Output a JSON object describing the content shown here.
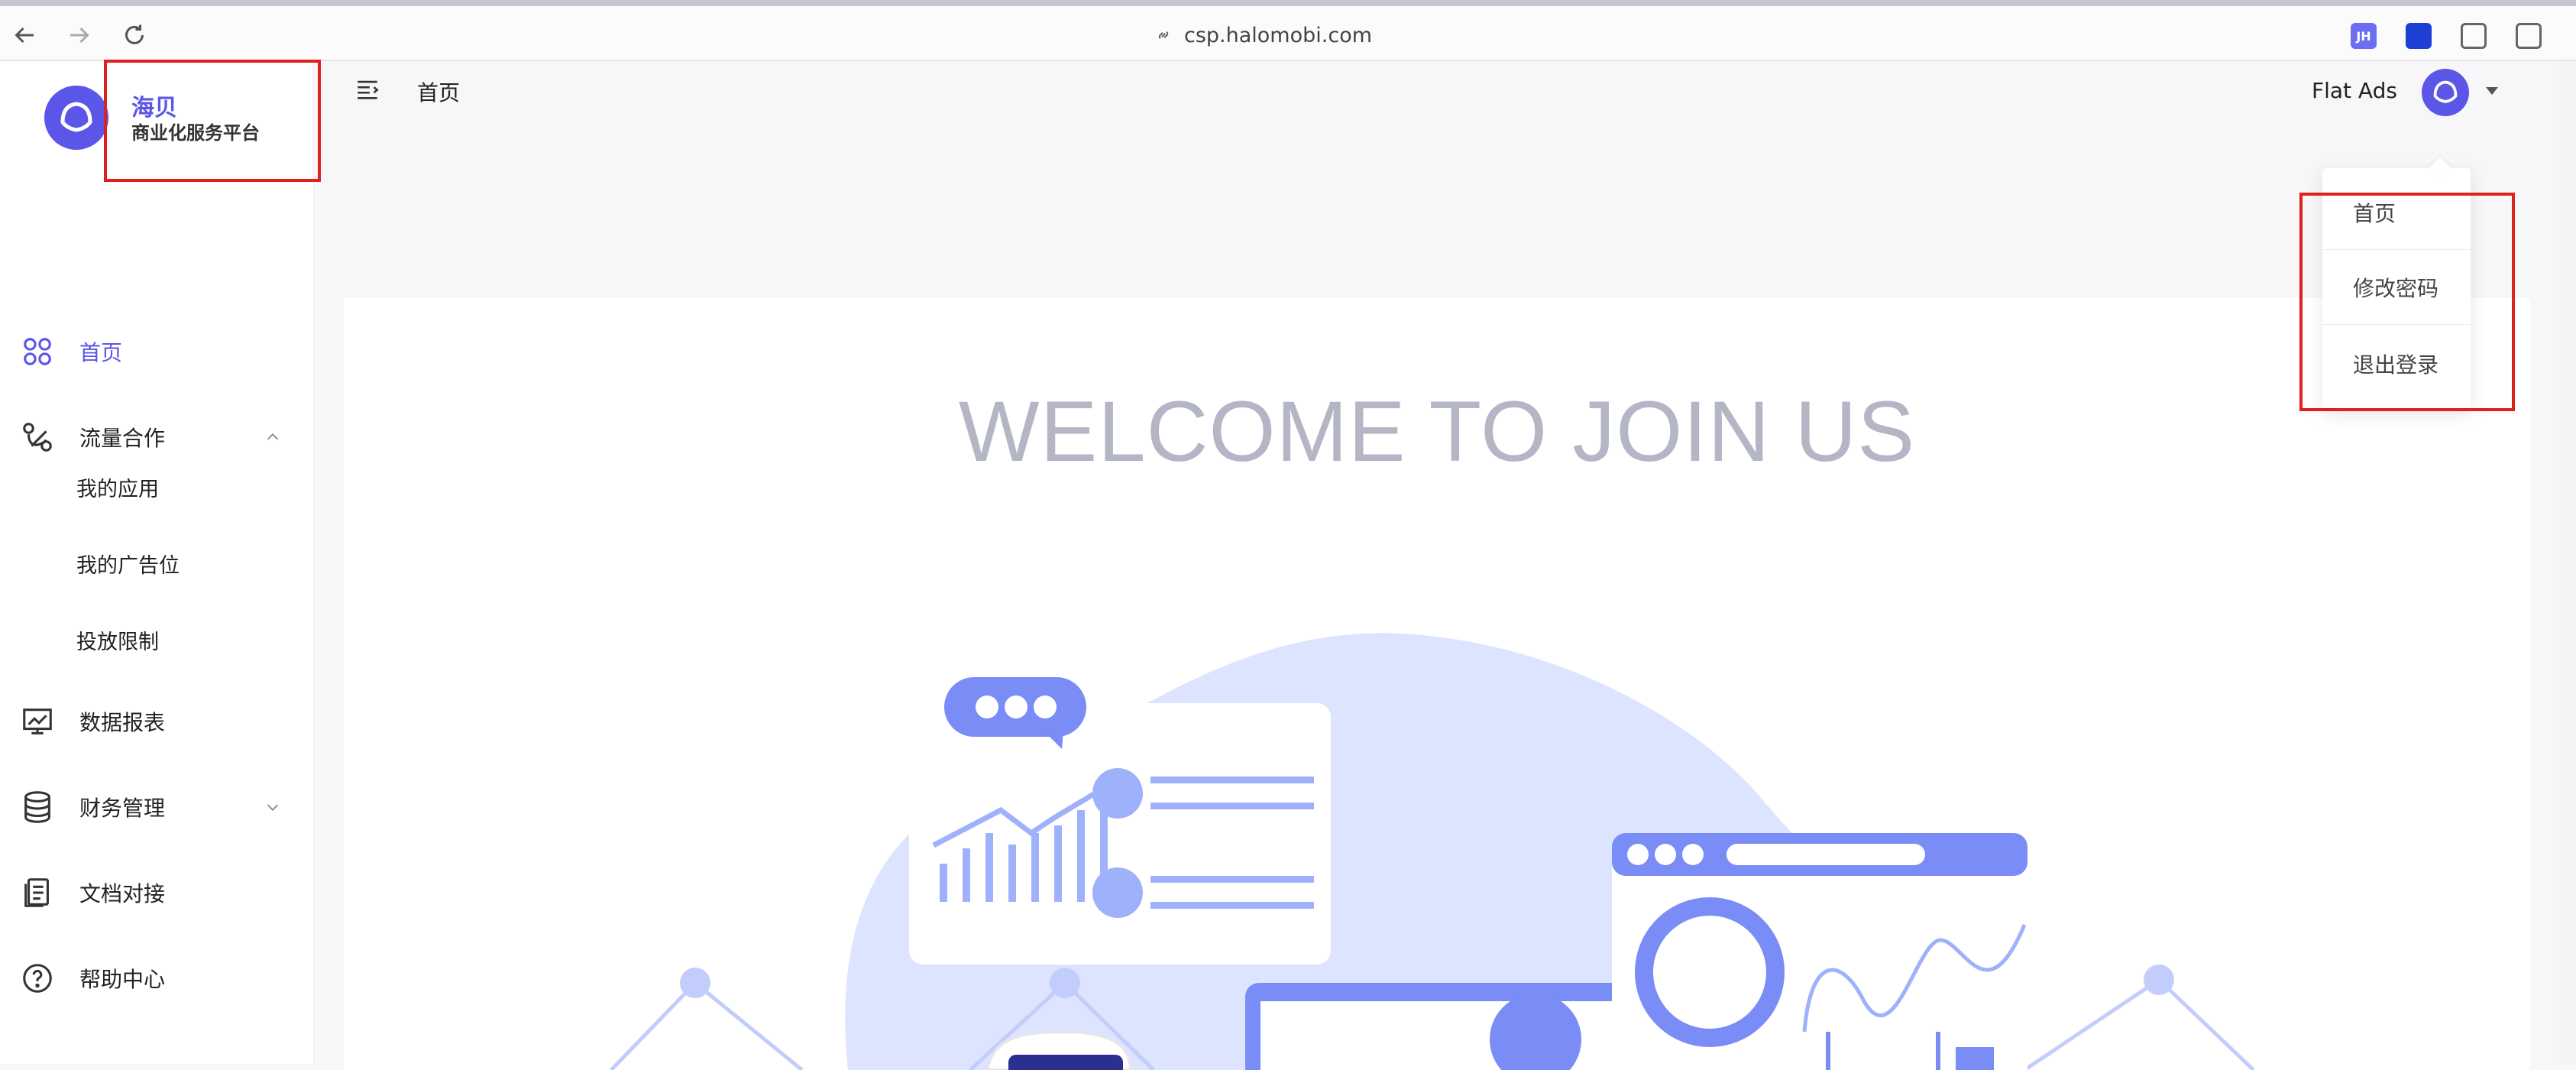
{
  "browser": {
    "url": "csp.halomobi.com",
    "ext_badge": "JH"
  },
  "brand": {
    "name": "海贝",
    "subtitle": "商业化服务平台",
    "accent": "#5b55e8"
  },
  "sidebar": {
    "items": [
      {
        "label": "首页",
        "icon": "home-grid-icon",
        "active": true
      },
      {
        "label": "流量合作",
        "icon": "traffic-icon",
        "expanded": true
      },
      {
        "label": "数据报表",
        "icon": "report-chart-icon"
      },
      {
        "label": "财务管理",
        "icon": "finance-database-icon",
        "expanded": false
      },
      {
        "label": "文档对接",
        "icon": "document-icon"
      },
      {
        "label": "帮助中心",
        "icon": "help-icon"
      }
    ],
    "submenu": [
      "我的应用",
      "我的广告位",
      "投放限制"
    ]
  },
  "header": {
    "breadcrumb": "首页",
    "account": "Flat Ads"
  },
  "dropdown": {
    "items": [
      "首页",
      "修改密码",
      "退出登录"
    ]
  },
  "main": {
    "welcome": "WELCOME TO JOIN US"
  },
  "colors": {
    "highlight_box": "#e0201c",
    "illustration_primary": "#7a8cf5",
    "illustration_light": "#dde4ff"
  }
}
